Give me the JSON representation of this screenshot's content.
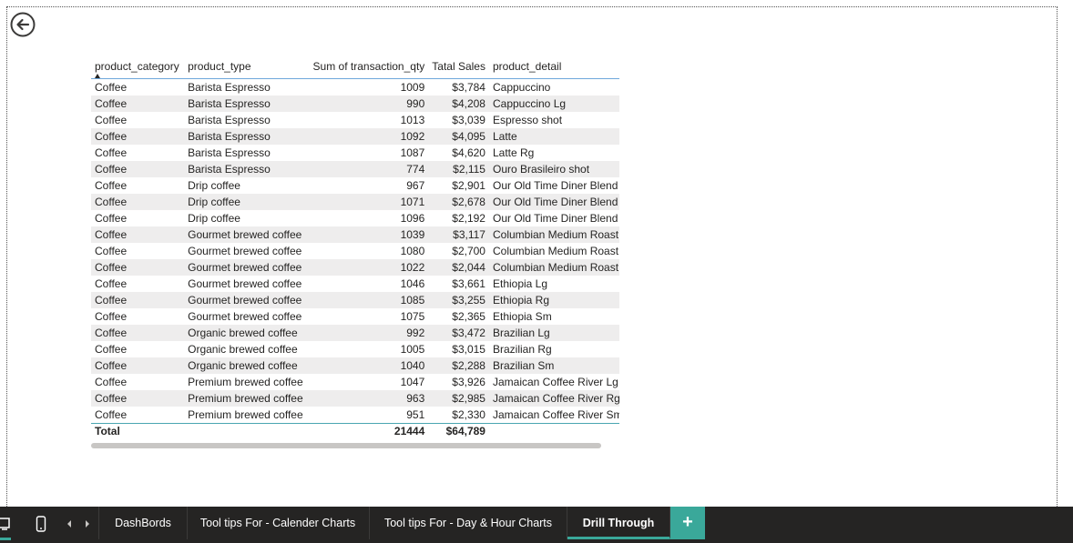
{
  "colors": {
    "accent": "#3aa89a",
    "tab_bg": "#252423",
    "header_line": "#6fa8dc",
    "row_stripe": "#eeeded"
  },
  "back_button": {
    "icon": "back-arrow-icon"
  },
  "table": {
    "headers": {
      "category": "product_category",
      "type": "product_type",
      "qty": "Sum of transaction_qty",
      "sales": "Tatal Sales",
      "detail": "product_detail"
    },
    "rows": [
      {
        "category": "Coffee",
        "type": "Barista Espresso",
        "qty": "1009",
        "sales": "$3,784",
        "detail": "Cappuccino"
      },
      {
        "category": "Coffee",
        "type": "Barista Espresso",
        "qty": "990",
        "sales": "$4,208",
        "detail": "Cappuccino Lg"
      },
      {
        "category": "Coffee",
        "type": "Barista Espresso",
        "qty": "1013",
        "sales": "$3,039",
        "detail": "Espresso shot"
      },
      {
        "category": "Coffee",
        "type": "Barista Espresso",
        "qty": "1092",
        "sales": "$4,095",
        "detail": "Latte"
      },
      {
        "category": "Coffee",
        "type": "Barista Espresso",
        "qty": "1087",
        "sales": "$4,620",
        "detail": "Latte Rg"
      },
      {
        "category": "Coffee",
        "type": "Barista Espresso",
        "qty": "774",
        "sales": "$2,115",
        "detail": "Ouro Brasileiro shot"
      },
      {
        "category": "Coffee",
        "type": "Drip coffee",
        "qty": "967",
        "sales": "$2,901",
        "detail": "Our Old Time Diner Blend I"
      },
      {
        "category": "Coffee",
        "type": "Drip coffee",
        "qty": "1071",
        "sales": "$2,678",
        "detail": "Our Old Time Diner Blend I"
      },
      {
        "category": "Coffee",
        "type": "Drip coffee",
        "qty": "1096",
        "sales": "$2,192",
        "detail": "Our Old Time Diner Blend S"
      },
      {
        "category": "Coffee",
        "type": "Gourmet brewed coffee",
        "qty": "1039",
        "sales": "$3,117",
        "detail": "Columbian Medium Roast I"
      },
      {
        "category": "Coffee",
        "type": "Gourmet brewed coffee",
        "qty": "1080",
        "sales": "$2,700",
        "detail": "Columbian Medium Roast I"
      },
      {
        "category": "Coffee",
        "type": "Gourmet brewed coffee",
        "qty": "1022",
        "sales": "$2,044",
        "detail": "Columbian Medium Roast S"
      },
      {
        "category": "Coffee",
        "type": "Gourmet brewed coffee",
        "qty": "1046",
        "sales": "$3,661",
        "detail": "Ethiopia Lg"
      },
      {
        "category": "Coffee",
        "type": "Gourmet brewed coffee",
        "qty": "1085",
        "sales": "$3,255",
        "detail": "Ethiopia Rg"
      },
      {
        "category": "Coffee",
        "type": "Gourmet brewed coffee",
        "qty": "1075",
        "sales": "$2,365",
        "detail": "Ethiopia Sm"
      },
      {
        "category": "Coffee",
        "type": "Organic brewed coffee",
        "qty": "992",
        "sales": "$3,472",
        "detail": "Brazilian Lg"
      },
      {
        "category": "Coffee",
        "type": "Organic brewed coffee",
        "qty": "1005",
        "sales": "$3,015",
        "detail": "Brazilian Rg"
      },
      {
        "category": "Coffee",
        "type": "Organic brewed coffee",
        "qty": "1040",
        "sales": "$2,288",
        "detail": "Brazilian Sm"
      },
      {
        "category": "Coffee",
        "type": "Premium brewed coffee",
        "qty": "1047",
        "sales": "$3,926",
        "detail": "Jamaican Coffee River Lg"
      },
      {
        "category": "Coffee",
        "type": "Premium brewed coffee",
        "qty": "963",
        "sales": "$2,985",
        "detail": "Jamaican Coffee River Rg"
      },
      {
        "category": "Coffee",
        "type": "Premium brewed coffee",
        "qty": "951",
        "sales": "$2,330",
        "detail": "Jamaican Coffee River Sm"
      }
    ],
    "total": {
      "label": "Total",
      "qty": "21444",
      "sales": "$64,789"
    }
  },
  "tabbar": {
    "icons": [
      "desktop-icon",
      "phone-icon",
      "prev-page-icon",
      "next-page-icon"
    ],
    "tabs": [
      {
        "label": "DashBords"
      },
      {
        "label": "Tool tips For - Calender Charts"
      },
      {
        "label": "Tool tips For - Day & Hour Charts"
      },
      {
        "label": "Drill Through"
      }
    ],
    "add_label": "+"
  }
}
